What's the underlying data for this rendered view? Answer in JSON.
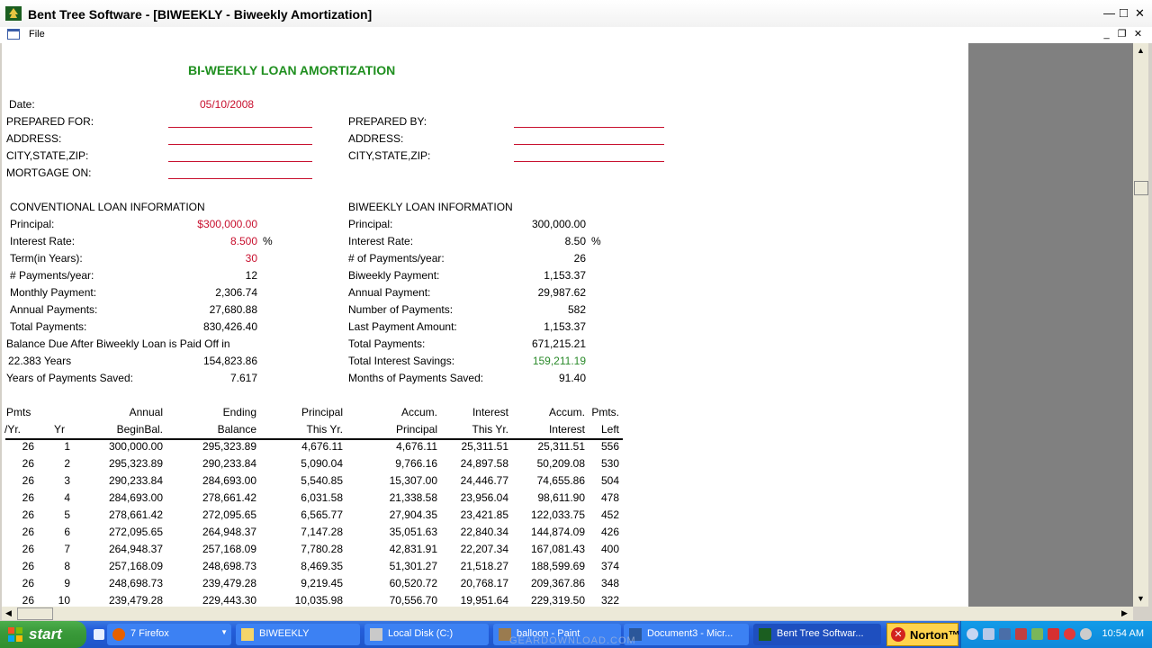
{
  "window": {
    "title": "Bent Tree Software - [BIWEEKLY - Biweekly Amortization]",
    "minimize": "—",
    "maximize": "□",
    "close": "✕",
    "mdi_minimize": "_",
    "mdi_restore": "❐",
    "mdi_close": "✕"
  },
  "menu": {
    "file": "File"
  },
  "report": {
    "heading": "BI-WEEKLY LOAN AMORTIZATION",
    "date_label": "Date:",
    "date_value": "05/10/2008",
    "prepared_for": "PREPARED FOR:",
    "address_left": "ADDRESS:",
    "city_left": "CITY,STATE,ZIP:",
    "mortgage_on": "MORTGAGE ON:",
    "prepared_by": "PREPARED BY:",
    "address_right": "ADDRESS:",
    "city_right": "CITY,STATE,ZIP:"
  },
  "conventional": {
    "heading": "CONVENTIONAL LOAN INFORMATION",
    "principal_label": "Principal:",
    "principal": "$300,000.00",
    "rate_label": "Interest Rate:",
    "rate": "8.500",
    "pct": "%",
    "term_label": "Term(in Years):",
    "term": "30",
    "ppy_label": "# Payments/year:",
    "ppy": "12",
    "monthly_label": "Monthly Payment:",
    "monthly": "2,306.74",
    "annual_label": "Annual Payments:",
    "annual": "27,680.88",
    "total_label": "Total Payments:",
    "total": "830,426.40",
    "balance_label": "Balance Due After Biweekly Loan is Paid Off in",
    "years_label": "22.383  Years",
    "balance_value": "154,823.86",
    "saved_label": "Years of Payments Saved:",
    "saved": "7.617"
  },
  "biweekly": {
    "heading": "BIWEEKLY LOAN INFORMATION",
    "principal_label": "Principal:",
    "principal": "300,000.00",
    "rate_label": "Interest Rate:",
    "rate": "8.50",
    "pct": "%",
    "ppy_label": "# of Payments/year:",
    "ppy": "26",
    "payment_label": "Biweekly Payment:",
    "payment": "1,153.37",
    "annual_label": "Annual Payment:",
    "annual": "29,987.62",
    "count_label": "Number of Payments:",
    "count": "582",
    "last_label": "Last Payment Amount:",
    "last": "1,153.37",
    "total_label": "Total Payments:",
    "total": "671,215.21",
    "savings_label": "Total Interest Savings:",
    "savings": "159,211.19",
    "months_label": "Months of Payments Saved:",
    "months": "91.40"
  },
  "table": {
    "headers_top": [
      "Pmts",
      "",
      "Annual",
      "Ending",
      "Principal",
      "Accum.",
      "Interest",
      "Accum.",
      "Pmts."
    ],
    "headers_bottom": [
      "/Yr.",
      "Yr",
      "BeginBal.",
      "Balance",
      "This Yr.",
      "Principal",
      "This Yr.",
      "Interest",
      "Left"
    ],
    "rows": [
      [
        "26",
        "1",
        "300,000.00",
        "295,323.89",
        "4,676.11",
        "4,676.11",
        "25,311.51",
        "25,311.51",
        "556"
      ],
      [
        "26",
        "2",
        "295,323.89",
        "290,233.84",
        "5,090.04",
        "9,766.16",
        "24,897.58",
        "50,209.08",
        "530"
      ],
      [
        "26",
        "3",
        "290,233.84",
        "284,693.00",
        "5,540.85",
        "15,307.00",
        "24,446.77",
        "74,655.86",
        "504"
      ],
      [
        "26",
        "4",
        "284,693.00",
        "278,661.42",
        "6,031.58",
        "21,338.58",
        "23,956.04",
        "98,611.90",
        "478"
      ],
      [
        "26",
        "5",
        "278,661.42",
        "272,095.65",
        "6,565.77",
        "27,904.35",
        "23,421.85",
        "122,033.75",
        "452"
      ],
      [
        "26",
        "6",
        "272,095.65",
        "264,948.37",
        "7,147.28",
        "35,051.63",
        "22,840.34",
        "144,874.09",
        "426"
      ],
      [
        "26",
        "7",
        "264,948.37",
        "257,168.09",
        "7,780.28",
        "42,831.91",
        "22,207.34",
        "167,081.43",
        "400"
      ],
      [
        "26",
        "8",
        "257,168.09",
        "248,698.73",
        "8,469.35",
        "51,301.27",
        "21,518.27",
        "188,599.69",
        "374"
      ],
      [
        "26",
        "9",
        "248,698.73",
        "239,479.28",
        "9,219.45",
        "60,520.72",
        "20,768.17",
        "209,367.86",
        "348"
      ],
      [
        "26",
        "10",
        "239,479.28",
        "229,443.30",
        "10,035.98",
        "70,556.70",
        "19,951.64",
        "229,319.50",
        "322"
      ]
    ]
  },
  "taskbar": {
    "start": "start",
    "tasks": [
      {
        "label": "7 Firefox",
        "icon": "firefox-icon"
      },
      {
        "label": "BIWEEKLY",
        "icon": "folder-icon"
      },
      {
        "label": "Local Disk (C:)",
        "icon": "drive-icon"
      },
      {
        "label": "balloon - Paint",
        "icon": "paint-icon"
      },
      {
        "label": "Document3 - Micr...",
        "icon": "word-icon"
      },
      {
        "label": "Bent Tree Softwar...",
        "icon": "tree-icon"
      }
    ],
    "norton": "Norton™",
    "clock": "10:54 AM",
    "watermark": "GEARDOWNLOAD.COM"
  }
}
